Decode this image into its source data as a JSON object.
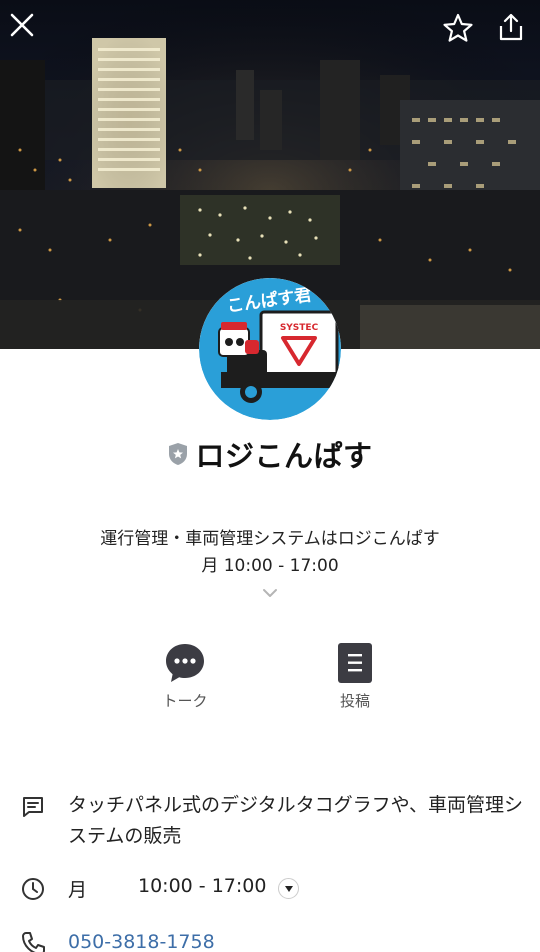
{
  "profile": {
    "name": "ロジこんぱす",
    "description": "運行管理・車両管理システムはロジこんぱす",
    "hours_summary": "月 10:00 - 17:00"
  },
  "avatar": {
    "badge_text": "こんぱす君",
    "brand_text": "SYSTEC"
  },
  "actions": [
    {
      "label": "トーク",
      "icon": "chat-bubble-icon"
    },
    {
      "label": "投稿",
      "icon": "post-document-icon"
    }
  ],
  "info": {
    "business": "タッチパネル式のデジタルタコグラフや、車両管理システムの販売",
    "hours_day": "月",
    "hours_time": "10:00 - 17:00",
    "phone": "050-3818-1758"
  },
  "colors": {
    "avatar_blue": "#2a9fd8",
    "brand_red": "#d7282f",
    "link_blue": "#3d6ea8"
  }
}
